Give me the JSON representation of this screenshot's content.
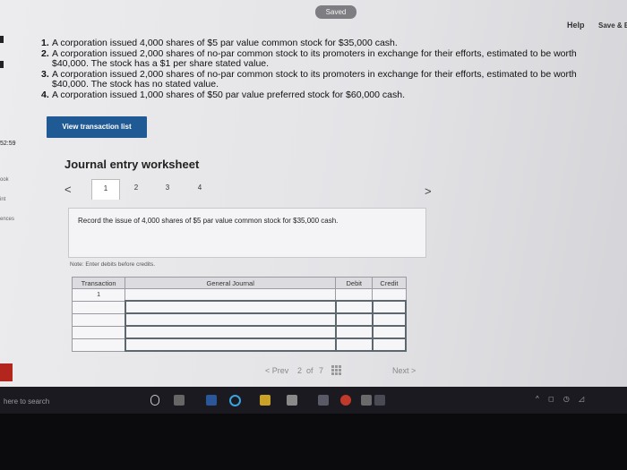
{
  "header": {
    "saved_label": "Saved",
    "help_label": "Help",
    "save_exit_label": "Save & E"
  },
  "problems": [
    {
      "num": "1.",
      "text": "A corporation issued 4,000 shares of $5 par value common stock for $35,000 cash."
    },
    {
      "num": "2.",
      "text": "A corporation issued 2,000 shares of no-par common stock to its promoters in exchange for their efforts, estimated to be worth $40,000. The stock has a $1 per share stated value."
    },
    {
      "num": "3.",
      "text": "A corporation issued 2,000 shares of no-par common stock to its promoters in exchange for their efforts, estimated to be worth $40,000. The stock has no stated value."
    },
    {
      "num": "4.",
      "text": "A corporation issued 1,000 shares of $50 par value preferred stock for $60,000 cash."
    }
  ],
  "buttons": {
    "view_transaction_list": "View transaction list"
  },
  "sidebar": {
    "timer": "52:59",
    "items": [
      "ook",
      "int",
      "ences"
    ]
  },
  "worksheet": {
    "title": "Journal entry worksheet",
    "prev_arrow": "<",
    "next_arrow": ">",
    "tabs": [
      "1",
      "2",
      "3",
      "4"
    ],
    "active_tab": "1",
    "instruction": "Record the issue of 4,000 shares of $5 par value common stock for $35,000 cash.",
    "note": "Note: Enter debits before credits."
  },
  "journal_table": {
    "headers": [
      "Transaction",
      "General Journal",
      "Debit",
      "Credit"
    ],
    "rows": [
      [
        "1",
        "",
        "",
        ""
      ],
      [
        "",
        "",
        "",
        ""
      ],
      [
        "",
        "",
        "",
        ""
      ],
      [
        "",
        "",
        "",
        ""
      ],
      [
        "",
        "",
        "",
        ""
      ]
    ]
  },
  "bottom_nav": {
    "prev_label": "< Prev",
    "page_current": "2",
    "page_sep": "of",
    "page_total": "7",
    "next_label": "Next >"
  },
  "taskbar": {
    "search_placeholder": "here to search"
  },
  "colors": {
    "accent_button": "#1f5a94",
    "taskbar": "#1a1a20",
    "left_red": "#b3261e"
  }
}
